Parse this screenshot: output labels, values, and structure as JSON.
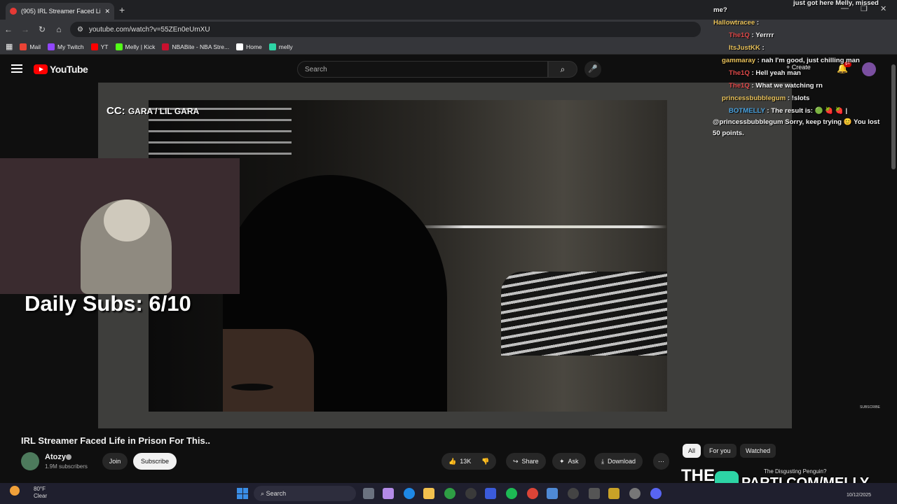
{
  "browser": {
    "tab_title": "(905) IRL Streamer Faced Lif",
    "tab_close": "✕",
    "new_tab": "+",
    "url": "youtube.com/watch?v=55ZEn0eUmXU",
    "bookmarks": [
      {
        "label": "Mail",
        "color": "#ea4335"
      },
      {
        "label": "My Twitch",
        "color": "#9146ff"
      },
      {
        "label": "YT",
        "color": "#ff0000"
      },
      {
        "label": "Melly | Kick",
        "color": "#53fc18"
      },
      {
        "label": "NBABite - NBA Stre...",
        "color": "#c8102e"
      },
      {
        "label": "Home",
        "color": "#ffffff"
      },
      {
        "label": "melly",
        "color": "#2dd4a5"
      }
    ]
  },
  "youtube": {
    "logo_text": "YouTube",
    "search_placeholder": "Search",
    "create_label": "+ Create",
    "notif_badge": "9+"
  },
  "video": {
    "cc_label": "CC:",
    "cc_names": "GARA / LIL GARA",
    "daily_subs": "Daily Subs: 6/10",
    "subscribe_small": "SUBSCRIBE"
  },
  "chat": [
    {
      "user": "",
      "text": "just got here Melly, missed",
      "color": "#ffffff"
    },
    {
      "user": "",
      "text": "me?",
      "color": "#ffffff"
    },
    {
      "user": "Hallowtracee",
      "text": ":",
      "color": "#e8c15a"
    },
    {
      "user": "The1Q",
      "text": ": Yerrrr",
      "color": "#e04a4a"
    },
    {
      "user": "ItsJustKK",
      "text": ":",
      "color": "#e8c15a"
    },
    {
      "user": "gammaray",
      "text": ": nah I'm good, just chilling man",
      "color": "#e8c15a"
    },
    {
      "user": "The1Q",
      "text": ": Hell yeah man",
      "color": "#e04a4a"
    },
    {
      "user": "The1Q",
      "text": ": What we watching rn",
      "color": "#e04a4a"
    },
    {
      "user": "princessbubblegum",
      "text": ": !slots",
      "color": "#e8c15a"
    },
    {
      "user": "BOTMELLY",
      "text": ": The result is: 🟢 🍓 🍓 |",
      "color": "#4aa3e0"
    },
    {
      "user": "",
      "text": "@princessbubblegum Sorry, keep trying 😊 You lost",
      "color": "#ffffff"
    },
    {
      "user": "",
      "text": "50 points.",
      "color": "#ffffff"
    }
  ],
  "details": {
    "title": "IRL Streamer Faced Life in Prison For This..",
    "channel": "Atozy",
    "subscribers": "1.9M subscribers",
    "join": "Join",
    "subscribe": "Subscribe",
    "likes": "13K",
    "share": "Share",
    "ask": "Ask",
    "download": "Download",
    "more": "⋯"
  },
  "recommend": {
    "chips": [
      "All",
      "For you",
      "Watched"
    ],
    "thumb_text": "THE",
    "first_title": "The Disgusting Penguin?"
  },
  "overlay": {
    "parti": "PARTI.COM/MELLY"
  },
  "taskbar": {
    "temp": "80°F",
    "weather": "Clear",
    "search": "Search",
    "date": "10/12/2025"
  }
}
